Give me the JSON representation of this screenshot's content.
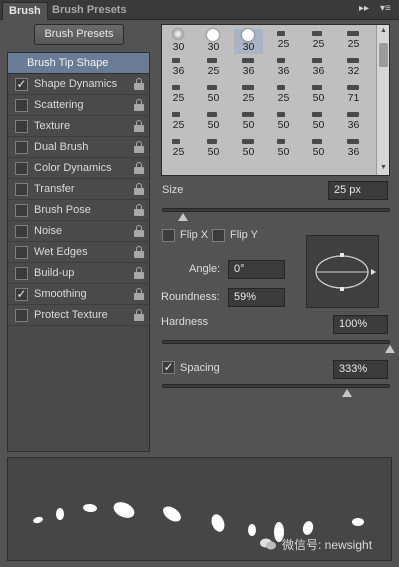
{
  "tabs": [
    {
      "label": "Brush",
      "active": true
    },
    {
      "label": "Brush Presets",
      "active": false
    }
  ],
  "header_icons": [
    "double-chevron-icon",
    "panel-menu-icon"
  ],
  "brush_presets_button": "Brush Presets",
  "tip_list": [
    {
      "label": "Brush Tip Shape",
      "selected": true,
      "checkbox": false,
      "lock": false
    },
    {
      "label": "Shape Dynamics",
      "checked": true,
      "lock": true
    },
    {
      "label": "Scattering",
      "checked": false,
      "lock": true
    },
    {
      "label": "Texture",
      "checked": false,
      "lock": true
    },
    {
      "label": "Dual Brush",
      "checked": false,
      "lock": true
    },
    {
      "label": "Color Dynamics",
      "checked": false,
      "lock": true
    },
    {
      "label": "Transfer",
      "checked": false,
      "lock": true
    },
    {
      "label": "Brush Pose",
      "checked": false,
      "lock": true
    },
    {
      "label": "Noise",
      "checked": false,
      "lock": true
    },
    {
      "label": "Wet Edges",
      "checked": false,
      "lock": true
    },
    {
      "label": "Build-up",
      "checked": false,
      "lock": true
    },
    {
      "label": "Smoothing",
      "checked": true,
      "lock": true
    },
    {
      "label": "Protect Texture",
      "checked": false,
      "lock": true
    }
  ],
  "brush_grid": {
    "selected_index": 2,
    "sizes": [
      "30",
      "30",
      "30",
      "25",
      "25",
      "25",
      "36",
      "25",
      "36",
      "36",
      "36",
      "32",
      "25",
      "50",
      "25",
      "25",
      "50",
      "71",
      "25",
      "50",
      "50",
      "50",
      "50",
      "36",
      "25",
      "50",
      "50",
      "50",
      "50",
      "36"
    ]
  },
  "size": {
    "label": "Size",
    "value": "25 px",
    "slider": 0.09
  },
  "flip_x": {
    "label": "Flip X",
    "checked": false
  },
  "flip_y": {
    "label": "Flip Y",
    "checked": false
  },
  "angle": {
    "label": "Angle:",
    "value": "0°"
  },
  "roundness": {
    "label": "Roundness:",
    "value": "59%"
  },
  "hardness": {
    "label": "Hardness",
    "value": "100%",
    "slider": 1.0
  },
  "spacing": {
    "label": "Spacing",
    "value": "333%",
    "checked": true,
    "slider": 0.81
  },
  "watermark": "微信号: newsight"
}
